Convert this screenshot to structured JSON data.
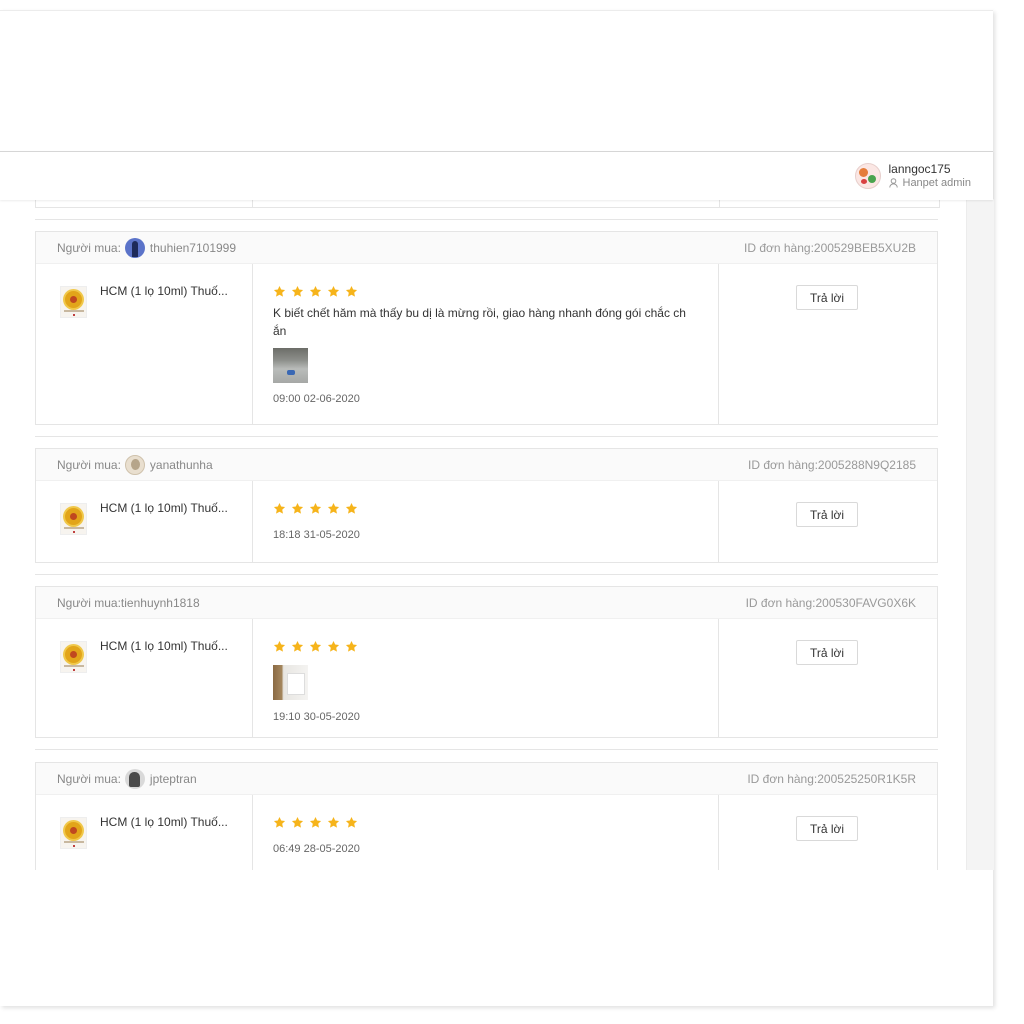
{
  "header": {
    "username": "lanngoc175",
    "role": "Hanpet admin"
  },
  "reviews": [
    {
      "buyer_label": "Người mua:",
      "buyer_name": "thuhien7101999",
      "order_id": "ID đơn hàng:200529BEB5XU2B",
      "product": "HCM (1 lọ 10ml) Thuố...",
      "rating": 5,
      "comment": "K biết chết hăm mà thấy bu dị là mừng rồi, giao hàng nhanh đóng gói chắc ch ắn",
      "date": "09:00 02-06-2020",
      "reply_label": "Trả lời"
    },
    {
      "buyer_label": "Người mua:",
      "buyer_name": "yanathunha",
      "order_id": "ID đơn hàng:2005288N9Q2185",
      "product": "HCM (1 lọ 10ml) Thuố...",
      "rating": 5,
      "date": "18:18 31-05-2020",
      "reply_label": "Trả lời"
    },
    {
      "buyer_label": "Người mua:tienhuynh1818",
      "order_id": "ID đơn hàng:200530FAVG0X6K",
      "product": "HCM (1 lọ 10ml) Thuố...",
      "rating": 5,
      "date": "19:10 30-05-2020",
      "reply_label": "Trả lời"
    },
    {
      "buyer_label": "Người mua:",
      "buyer_name": "jpteptran",
      "order_id": "ID đơn hàng:200525250R1K5R",
      "product": "HCM (1 lọ 10ml) Thuố...",
      "rating": 5,
      "date": "06:49 28-05-2020",
      "reply_label": "Trả lời"
    }
  ],
  "colors": {
    "star": "#f6b41b",
    "border": "#e5e5e5",
    "header_bg": "#fafafa"
  }
}
